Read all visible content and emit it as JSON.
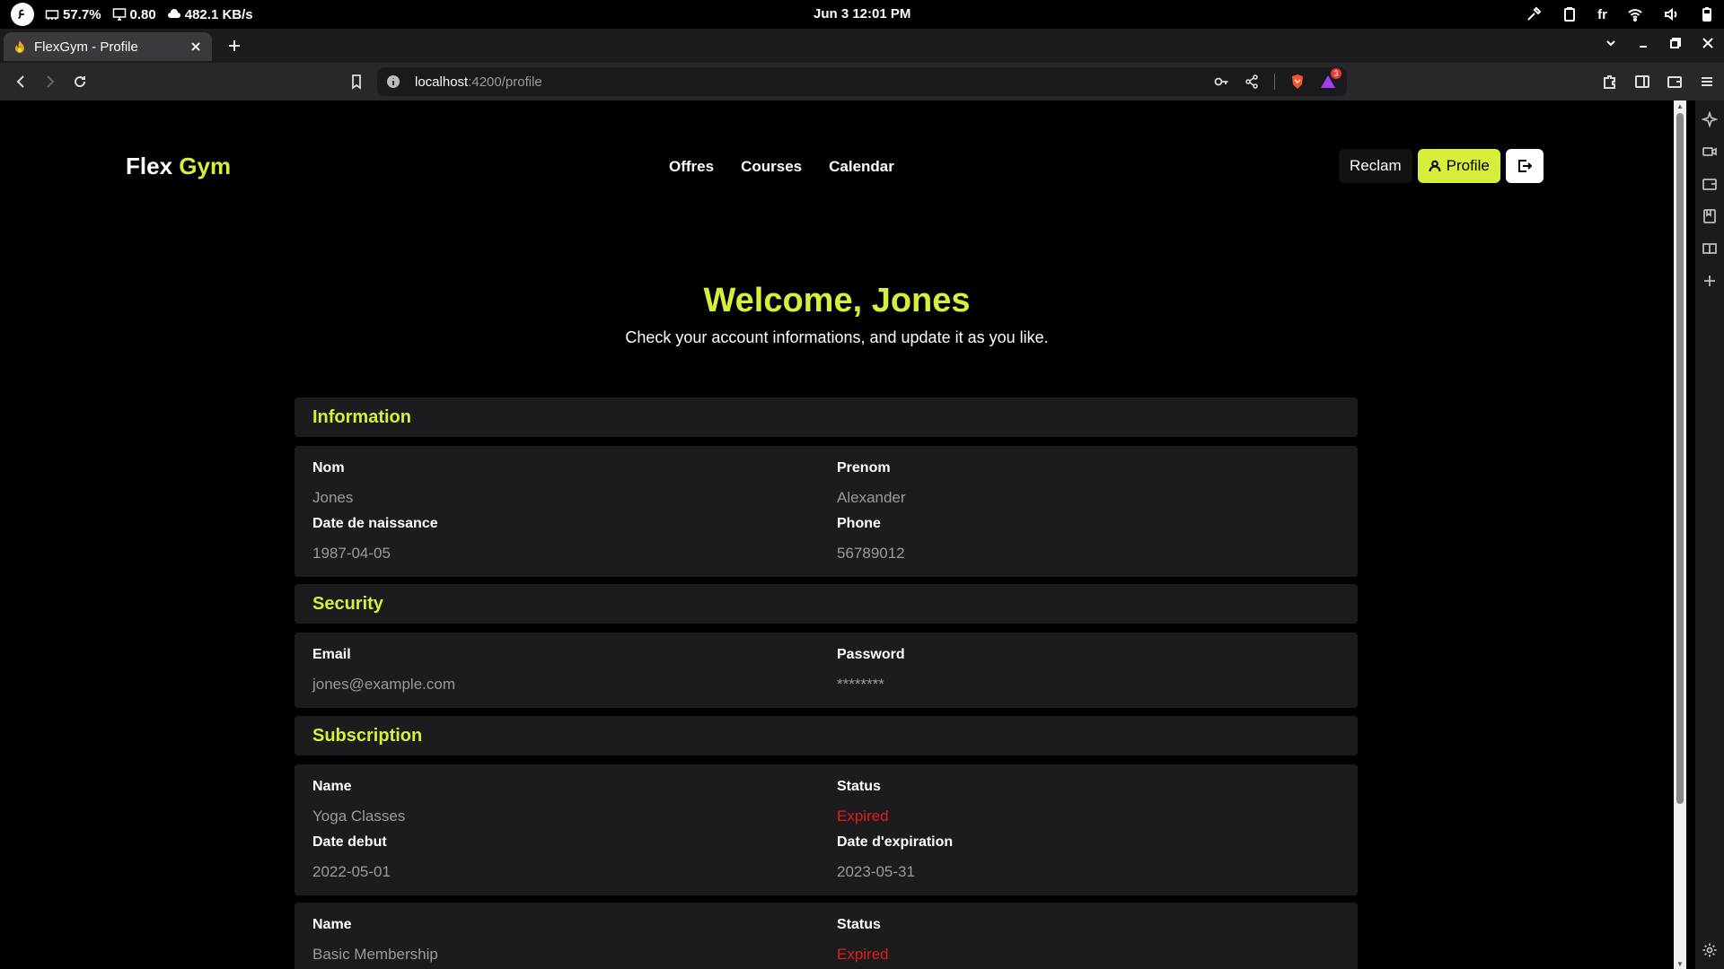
{
  "os": {
    "battery_stat": "57.7%",
    "load_stat": "0.80",
    "net_stat": "482.1 KB/s",
    "datetime": "Jun 3  12:01 PM",
    "lang": "fr"
  },
  "browser": {
    "tab_title": "FlexGym - Profile",
    "url_host": "localhost",
    "url_rest": ":4200/profile",
    "notification_count": "3"
  },
  "site": {
    "brand_main": "Flex",
    "brand_accent": "Gym",
    "nav": [
      "Offres",
      "Courses",
      "Calendar"
    ],
    "reclam_label": "Reclam",
    "profile_label": "Profile",
    "accent_color": "#d7ee3a",
    "expired_color": "#e31b1b"
  },
  "welcome": {
    "title": "Welcome, Jones",
    "subtitle": "Check your account informations, and update it as you like."
  },
  "information": {
    "heading": "Information",
    "nom_label": "Nom",
    "nom": "Jones",
    "prenom_label": "Prenom",
    "prenom": "Alexander",
    "dob_label": "Date de naissance",
    "dob": "1987-04-05",
    "phone_label": "Phone",
    "phone": "56789012"
  },
  "security": {
    "heading": "Security",
    "email_label": "Email",
    "email": "jones@example.com",
    "password_label": "Password",
    "password": "********"
  },
  "subscription": {
    "heading": "Subscription",
    "items": [
      {
        "name_label": "Name",
        "name": "Yoga Classes",
        "status_label": "Status",
        "status": "Expired",
        "start_label": "Date debut",
        "start": "2022-05-01",
        "end_label": "Date d'expiration",
        "end": "2023-05-31"
      },
      {
        "name_label": "Name",
        "name": "Basic Membership",
        "status_label": "Status",
        "status": "Expired"
      }
    ]
  }
}
